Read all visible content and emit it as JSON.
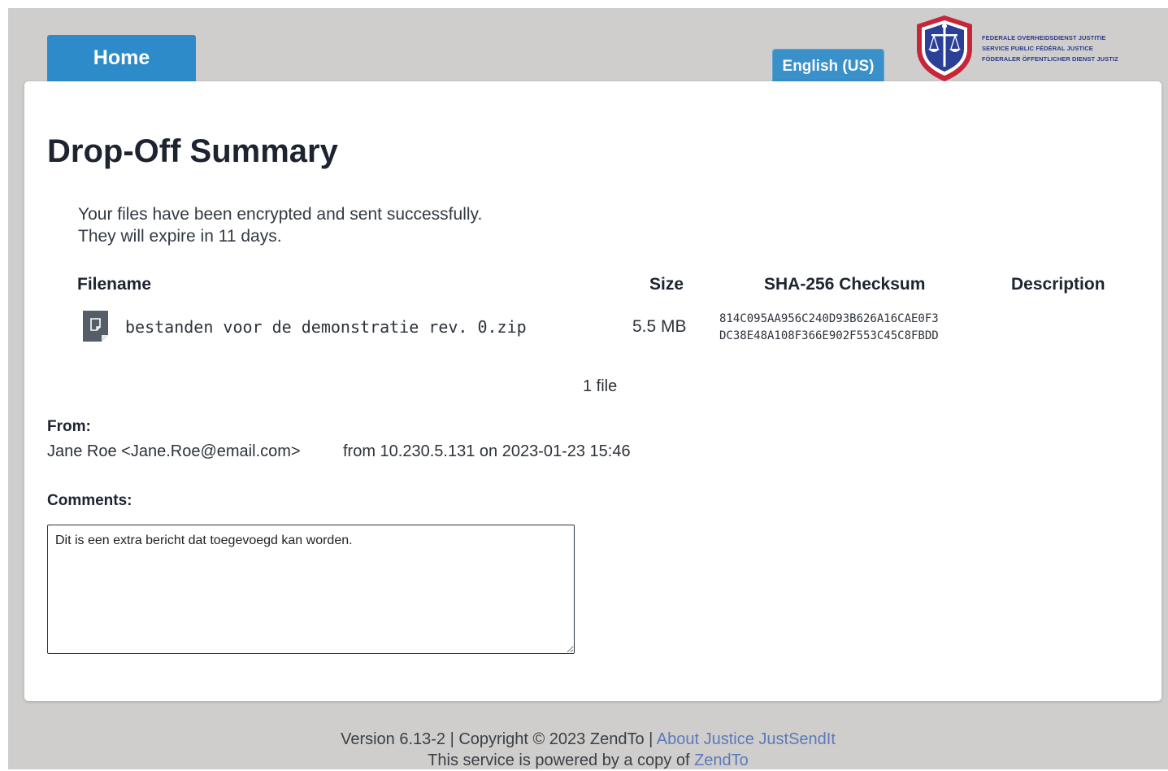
{
  "nav": {
    "home_label": "Home",
    "language_label": "English (US)"
  },
  "logo": {
    "line1": "FEDERALE OVERHEIDSDIENST JUSTITIE",
    "line2": "SERVICE PUBLIC FÉDÉRAL JUSTICE",
    "line3": "FÖDERALER ÖFFENTLICHER DIENST JUSTIZ"
  },
  "page": {
    "title": "Drop-Off Summary",
    "message_line1": "Your files have been encrypted and sent successfully.",
    "message_line2": "They will expire in 11 days."
  },
  "table": {
    "headers": {
      "filename": "Filename",
      "size": "Size",
      "checksum": "SHA-256 Checksum",
      "description": "Description"
    },
    "rows": [
      {
        "filename": "bestanden voor de demonstratie rev. 0.zip",
        "size": "5.5 MB",
        "checksum_line1": "814C095AA956C240D93B626A16CAE0F3",
        "checksum_line2": "DC38E48A108F366E902F553C45C8FBDD",
        "description": "",
        "icon": "file-icon"
      }
    ],
    "file_count": "1 file"
  },
  "sender": {
    "label": "From:",
    "name_email": "Jane Roe <Jane.Roe@email.com>",
    "origin": "from 10.230.5.131 on 2023-01-23 15:46"
  },
  "comments": {
    "label": "Comments:",
    "value": "Dit is een extra bericht dat toegevoegd kan worden."
  },
  "footer": {
    "version_text": "Version 6.13-2 | Copyright © 2023 ZendTo | ",
    "about_link": "About Justice JustSendIt",
    "powered_text": "This service is powered by a copy of ",
    "zendto_link": "ZendTo"
  },
  "colors": {
    "accent": "#2e8bc9",
    "background": "#cfcecd",
    "link": "#5b7ab8"
  }
}
